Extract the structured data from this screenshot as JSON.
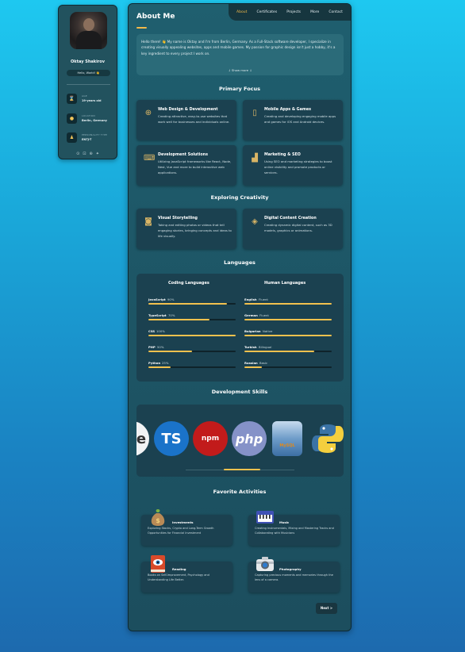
{
  "profile": {
    "name": "Oktay Shakirov",
    "tag": "Hello, World! 👋",
    "info": [
      {
        "icon": "hourglass-icon",
        "glyph": "⌛",
        "label": "AGE",
        "value": "19-years old"
      },
      {
        "icon": "location-icon",
        "glyph": "●",
        "label": "LOCATION",
        "value": "Berlin, Germany"
      },
      {
        "icon": "person-icon",
        "glyph": "♟",
        "label": "PERSONALITY TYPE",
        "value": "ENTJ-T"
      }
    ],
    "socials": [
      "⊙",
      "⊡",
      "⊕",
      "✦"
    ]
  },
  "nav": {
    "about": "About",
    "certificates": "Certificates",
    "projects": "Projects",
    "more": "More",
    "contact": "Contact"
  },
  "main": {
    "title": "About Me",
    "intro": "Hello there! 👋 My name is Oktay and I'm from Berlin, Germany. As a Full-Stack software developer, I specialize in creating visually appealing websites, apps and mobile games. My passion for graphic design isn't just a hobby, it's a key ingredient to every project I work on.",
    "show_more": "↓  Show more  ↓"
  },
  "primary_focus": {
    "title": "Primary Focus",
    "cards": [
      {
        "icon": "globe-icon",
        "glyph": "⊕",
        "title": "Web Design & Development",
        "desc": "Creating attractive, easy-to-use websites that work well for businesses and individuals online."
      },
      {
        "icon": "mobile-icon",
        "glyph": "▯",
        "title": "Mobile Apps & Games",
        "desc": "Creating and developing engaging mobile apps and games for iOS and Android devices."
      },
      {
        "icon": "code-icon",
        "glyph": "⌨",
        "title": "Development Solutions",
        "desc": "Utilizing JavaScript frameworks like React, Node, Nest, Vue and more to build interactive web applications."
      },
      {
        "icon": "chart-icon",
        "glyph": "▟",
        "title": "Marketing & SEO",
        "desc": "Using SEO and marketing strategies to boost online visibility and promote products or services."
      }
    ]
  },
  "creativity": {
    "title": "Exploring Creativity",
    "cards": [
      {
        "icon": "camera-icon",
        "glyph": "◙",
        "title": "Visual Storytelling",
        "desc": "Taking and editing photos or videos that tell engaging stories, bringing concepts and ideas to life visually."
      },
      {
        "icon": "cube-icon",
        "glyph": "◈",
        "title": "Digital Content Creation",
        "desc": "Creating dynamic digital content, such as 3D models, graphics or animations."
      }
    ]
  },
  "languages": {
    "title": "Languages",
    "coding_title": "Coding Languages",
    "human_title": "Human Languages",
    "coding": [
      {
        "name": "JavaScript",
        "level": "90%",
        "fill": 0.9
      },
      {
        "name": "TypeScript",
        "level": "70%",
        "fill": 0.7
      },
      {
        "name": "CSS",
        "level": "100%",
        "fill": 1.0
      },
      {
        "name": "PHP",
        "level": "50%",
        "fill": 0.5
      },
      {
        "name": "Python",
        "level": "25%",
        "fill": 0.25
      }
    ],
    "human": [
      {
        "name": "English",
        "level": "Fluent",
        "fill": 1.0
      },
      {
        "name": "German",
        "level": "Fluent",
        "fill": 1.0
      },
      {
        "name": "Bulgarian",
        "level": "Native",
        "fill": 1.0
      },
      {
        "name": "Turkish",
        "level": "Bilingual",
        "fill": 0.8
      },
      {
        "name": "Russian",
        "level": "Basic",
        "fill": 0.2
      }
    ]
  },
  "skills": {
    "title": "Development Skills",
    "logos": [
      {
        "icon": "partial-logo-icon",
        "text": "e"
      },
      {
        "icon": "typescript-logo-icon",
        "text": "TS"
      },
      {
        "icon": "npm-logo-icon",
        "text": "npm"
      },
      {
        "icon": "php-logo-icon",
        "text": "php"
      },
      {
        "icon": "mysql-logo-icon",
        "text": "MySQL"
      },
      {
        "icon": "python-logo-icon",
        "text": ""
      }
    ]
  },
  "activities": {
    "title": "Favorite Activities",
    "items": [
      {
        "icon": "money-bag-icon",
        "title": "Investments",
        "desc": "Exploring Stocks, Crypto and Long-Term Growth Opportunities for Financial Investment"
      },
      {
        "icon": "piano-icon",
        "title": "Music",
        "desc": "Creating Instrumentals, Mixing and Mastering Tracks and Collaborating with Musicians"
      },
      {
        "icon": "book-icon",
        "title": "Reading",
        "desc": "Books on Self-Improvement, Psychology and Understanding Life Better."
      },
      {
        "icon": "camera-photo-icon",
        "title": "Photography",
        "desc": "Capturing precious moments and memories through the lens of a camera."
      }
    ]
  },
  "next_label": "Next >"
}
